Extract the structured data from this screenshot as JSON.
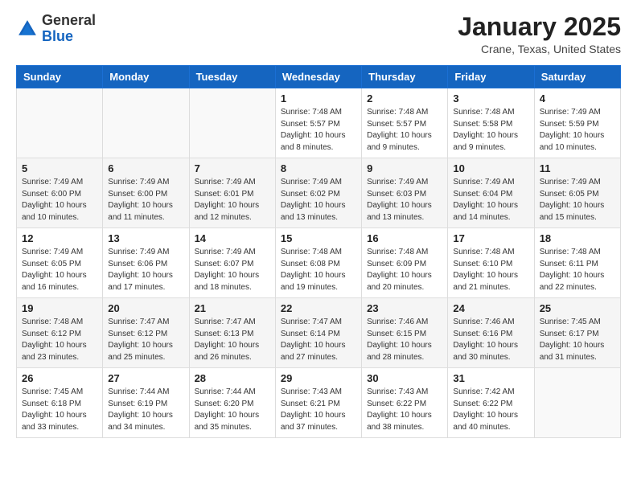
{
  "header": {
    "logo_general": "General",
    "logo_blue": "Blue",
    "month_year": "January 2025",
    "location": "Crane, Texas, United States"
  },
  "weekdays": [
    "Sunday",
    "Monday",
    "Tuesday",
    "Wednesday",
    "Thursday",
    "Friday",
    "Saturday"
  ],
  "weeks": [
    [
      {
        "day": "",
        "info": ""
      },
      {
        "day": "",
        "info": ""
      },
      {
        "day": "",
        "info": ""
      },
      {
        "day": "1",
        "info": "Sunrise: 7:48 AM\nSunset: 5:57 PM\nDaylight: 10 hours\nand 8 minutes."
      },
      {
        "day": "2",
        "info": "Sunrise: 7:48 AM\nSunset: 5:57 PM\nDaylight: 10 hours\nand 9 minutes."
      },
      {
        "day": "3",
        "info": "Sunrise: 7:48 AM\nSunset: 5:58 PM\nDaylight: 10 hours\nand 9 minutes."
      },
      {
        "day": "4",
        "info": "Sunrise: 7:49 AM\nSunset: 5:59 PM\nDaylight: 10 hours\nand 10 minutes."
      }
    ],
    [
      {
        "day": "5",
        "info": "Sunrise: 7:49 AM\nSunset: 6:00 PM\nDaylight: 10 hours\nand 10 minutes."
      },
      {
        "day": "6",
        "info": "Sunrise: 7:49 AM\nSunset: 6:00 PM\nDaylight: 10 hours\nand 11 minutes."
      },
      {
        "day": "7",
        "info": "Sunrise: 7:49 AM\nSunset: 6:01 PM\nDaylight: 10 hours\nand 12 minutes."
      },
      {
        "day": "8",
        "info": "Sunrise: 7:49 AM\nSunset: 6:02 PM\nDaylight: 10 hours\nand 13 minutes."
      },
      {
        "day": "9",
        "info": "Sunrise: 7:49 AM\nSunset: 6:03 PM\nDaylight: 10 hours\nand 13 minutes."
      },
      {
        "day": "10",
        "info": "Sunrise: 7:49 AM\nSunset: 6:04 PM\nDaylight: 10 hours\nand 14 minutes."
      },
      {
        "day": "11",
        "info": "Sunrise: 7:49 AM\nSunset: 6:05 PM\nDaylight: 10 hours\nand 15 minutes."
      }
    ],
    [
      {
        "day": "12",
        "info": "Sunrise: 7:49 AM\nSunset: 6:05 PM\nDaylight: 10 hours\nand 16 minutes."
      },
      {
        "day": "13",
        "info": "Sunrise: 7:49 AM\nSunset: 6:06 PM\nDaylight: 10 hours\nand 17 minutes."
      },
      {
        "day": "14",
        "info": "Sunrise: 7:49 AM\nSunset: 6:07 PM\nDaylight: 10 hours\nand 18 minutes."
      },
      {
        "day": "15",
        "info": "Sunrise: 7:48 AM\nSunset: 6:08 PM\nDaylight: 10 hours\nand 19 minutes."
      },
      {
        "day": "16",
        "info": "Sunrise: 7:48 AM\nSunset: 6:09 PM\nDaylight: 10 hours\nand 20 minutes."
      },
      {
        "day": "17",
        "info": "Sunrise: 7:48 AM\nSunset: 6:10 PM\nDaylight: 10 hours\nand 21 minutes."
      },
      {
        "day": "18",
        "info": "Sunrise: 7:48 AM\nSunset: 6:11 PM\nDaylight: 10 hours\nand 22 minutes."
      }
    ],
    [
      {
        "day": "19",
        "info": "Sunrise: 7:48 AM\nSunset: 6:12 PM\nDaylight: 10 hours\nand 23 minutes."
      },
      {
        "day": "20",
        "info": "Sunrise: 7:47 AM\nSunset: 6:12 PM\nDaylight: 10 hours\nand 25 minutes."
      },
      {
        "day": "21",
        "info": "Sunrise: 7:47 AM\nSunset: 6:13 PM\nDaylight: 10 hours\nand 26 minutes."
      },
      {
        "day": "22",
        "info": "Sunrise: 7:47 AM\nSunset: 6:14 PM\nDaylight: 10 hours\nand 27 minutes."
      },
      {
        "day": "23",
        "info": "Sunrise: 7:46 AM\nSunset: 6:15 PM\nDaylight: 10 hours\nand 28 minutes."
      },
      {
        "day": "24",
        "info": "Sunrise: 7:46 AM\nSunset: 6:16 PM\nDaylight: 10 hours\nand 30 minutes."
      },
      {
        "day": "25",
        "info": "Sunrise: 7:45 AM\nSunset: 6:17 PM\nDaylight: 10 hours\nand 31 minutes."
      }
    ],
    [
      {
        "day": "26",
        "info": "Sunrise: 7:45 AM\nSunset: 6:18 PM\nDaylight: 10 hours\nand 33 minutes."
      },
      {
        "day": "27",
        "info": "Sunrise: 7:44 AM\nSunset: 6:19 PM\nDaylight: 10 hours\nand 34 minutes."
      },
      {
        "day": "28",
        "info": "Sunrise: 7:44 AM\nSunset: 6:20 PM\nDaylight: 10 hours\nand 35 minutes."
      },
      {
        "day": "29",
        "info": "Sunrise: 7:43 AM\nSunset: 6:21 PM\nDaylight: 10 hours\nand 37 minutes."
      },
      {
        "day": "30",
        "info": "Sunrise: 7:43 AM\nSunset: 6:22 PM\nDaylight: 10 hours\nand 38 minutes."
      },
      {
        "day": "31",
        "info": "Sunrise: 7:42 AM\nSunset: 6:22 PM\nDaylight: 10 hours\nand 40 minutes."
      },
      {
        "day": "",
        "info": ""
      }
    ]
  ],
  "accent_color": "#1565c0"
}
